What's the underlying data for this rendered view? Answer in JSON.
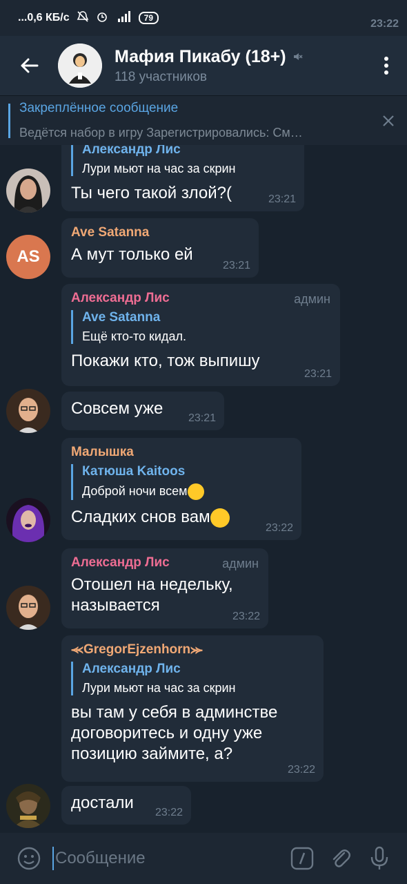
{
  "status": {
    "time": "23:22",
    "speed": "...0,6 КБ/с",
    "battery": "79"
  },
  "header": {
    "title": "Мафия Пикабу (18+)",
    "subtitle": "118 участников"
  },
  "pinned": {
    "title": "Закреплённое сообщение",
    "body": "Ведётся набор в игру   Зарегистрировались: См…"
  },
  "messages": [
    {
      "reply_name": "Александр Лис",
      "reply_text": "Лури мьют на час за скрин",
      "text": "Ты чего такой злой?(",
      "time": "23:21"
    },
    {
      "avatar_initials": "AS",
      "name": "Ave Satanna",
      "name_color": "#f0a875",
      "text": "А мут только ей",
      "time": "23:21"
    },
    {
      "name": "Александр Лис",
      "name_color": "#ee6d93",
      "badge": "админ",
      "reply_name": "Ave Satanna",
      "reply_text": "Ещё кто-то кидал.",
      "text": "Покажи кто, тож выпишу",
      "time": "23:21"
    },
    {
      "text": "Совсем уже",
      "time": "23:21"
    },
    {
      "name": "Малышка",
      "name_color": "#f0a875",
      "reply_name": "Катюша Kaitoos",
      "reply_text": "Доброй ночи всем",
      "text": "Сладких снов вам",
      "time": "23:22"
    },
    {
      "name": "Александр Лис",
      "name_color": "#ee6d93",
      "badge": "админ",
      "text_line1": "Отошел на недельку,",
      "text_line2": "называется",
      "time": "23:22"
    },
    {
      "name": "⪻GregorEjzenhorn⪼",
      "name_color": "#f0a875",
      "reply_name": "Александр Лис",
      "reply_text": "Лури мьют на час за скрин",
      "text_line1": "вы там у себя в админстве",
      "text_line2": "договоритесь и одну уже",
      "text_line3": "позицию займите, а?",
      "time": "23:22"
    },
    {
      "text": "достали",
      "time": "23:22"
    }
  ],
  "composer": {
    "placeholder": "Сообщение"
  },
  "colors": {
    "accent": "#5aa5e3",
    "bubble": "#212c39",
    "background": "#18222d"
  }
}
